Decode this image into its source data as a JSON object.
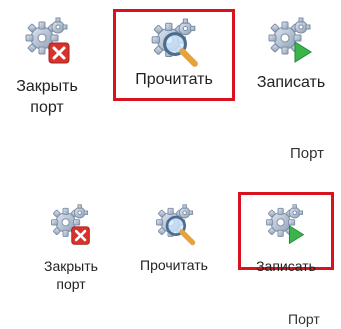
{
  "groups": [
    {
      "name": "Порт",
      "buttons": {
        "close": {
          "label_line1": "Закрыть",
          "label_line2": "порт",
          "icon": "gear-close-icon",
          "highlighted": false
        },
        "read": {
          "label": "Прочитать",
          "icon": "gear-magnifier-icon",
          "highlighted": true
        },
        "write": {
          "label": "Записать",
          "icon": "gear-play-icon",
          "highlighted": false
        }
      }
    },
    {
      "name": "Порт",
      "buttons": {
        "close": {
          "label_line1": "Закрыть",
          "label_line2": "порт",
          "icon": "gear-close-icon",
          "highlighted": false
        },
        "read": {
          "label": "Прочитать",
          "icon": "gear-magnifier-icon",
          "highlighted": false
        },
        "write": {
          "label": "Записать",
          "icon": "gear-play-icon",
          "highlighted": true
        }
      }
    }
  ],
  "colors": {
    "highlight": "#d9121f",
    "gear": "#b9c6d6",
    "close_badge": "#d9322b",
    "play_badge": "#3bb54a",
    "magnifier": "#e8a23a"
  }
}
